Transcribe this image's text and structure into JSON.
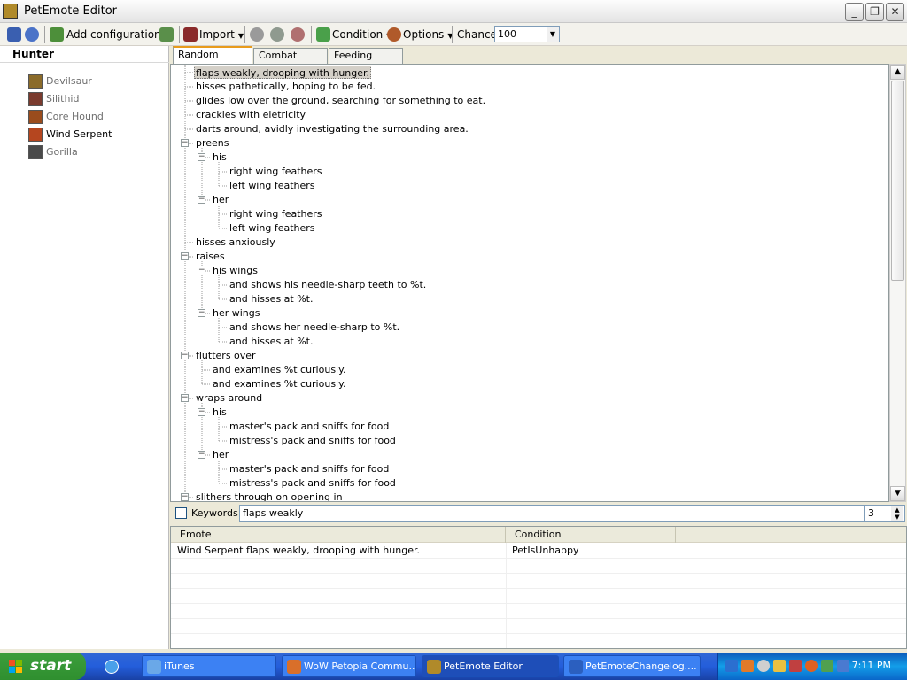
{
  "window": {
    "title": "PetEmote Editor"
  },
  "toolbar": {
    "add_configuration": "Add configuration",
    "import": "Import",
    "condition": "Condition",
    "options": "Options",
    "chance_label": "Chance",
    "chance_value": "100"
  },
  "sidebar": {
    "title": "Hunter",
    "pets": [
      {
        "label": "Devilsaur",
        "icon": "devilsaur-icon",
        "color": "#8b6b2a"
      },
      {
        "label": "Silithid",
        "icon": "silithid-icon",
        "color": "#7a3b2e"
      },
      {
        "label": "Core Hound",
        "icon": "core-hound-icon",
        "color": "#9a4c1d"
      },
      {
        "label": "Wind Serpent",
        "icon": "wind-serpent-icon",
        "color": "#b5461f"
      },
      {
        "label": "Gorilla",
        "icon": "gorilla-icon",
        "color": "#4a4a4a"
      }
    ]
  },
  "tabs": [
    "Random Emotes",
    "Combat Emotes",
    "Feeding Emotes"
  ],
  "tree": [
    "flaps weakly, drooping with hunger.",
    "hisses pathetically, hoping to be fed.",
    "glides low over the ground, searching for something to eat.",
    "crackles with eletricity",
    "darts around, avidly investigating the surrounding area.",
    "preens",
    "his",
    "right wing feathers",
    "left wing feathers",
    "her",
    "right wing feathers",
    "left wing feathers",
    "hisses anxiously",
    "raises",
    "his wings",
    "and shows his needle-sharp teeth to %t.",
    "and hisses at %t.",
    "her wings",
    "and shows her needle-sharp to %t.",
    "and hisses at %t.",
    "flutters over",
    "and examines %t curiously.",
    "and examines %t curiously.",
    "wraps around",
    "his",
    "master's pack and sniffs for food",
    "mistress's pack and sniffs for food",
    "her",
    "master's pack and sniffs for food",
    "mistress's pack and sniffs for food",
    "slithers through on opening in"
  ],
  "keywords": {
    "label": "Keywords",
    "value": "flaps weakly",
    "count": "3"
  },
  "results": {
    "columns": [
      "Emote",
      "Condition"
    ],
    "rows": [
      {
        "emote": "Wind Serpent flaps weakly, drooping with hunger.",
        "condition": "PetIsUnhappy"
      }
    ]
  },
  "taskbar": {
    "start": "start",
    "tasks": [
      {
        "label": "iTunes",
        "color": "#6aa8e8"
      },
      {
        "label": "WoW Petopia Commu...",
        "color": "#d96f2a"
      },
      {
        "label": "PetEmote Editor",
        "color": "#b08a2a"
      },
      {
        "label": "PetEmoteChangelog....",
        "color": "#2b5fbf"
      }
    ],
    "clock": "7:11 PM"
  }
}
